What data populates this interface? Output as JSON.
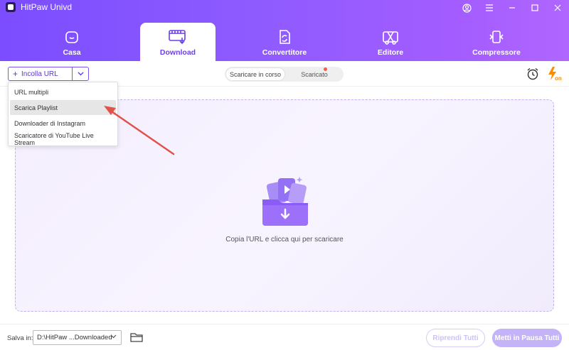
{
  "app": {
    "title": "HitPaw Univd"
  },
  "tabs": [
    {
      "label": "Casa",
      "icon": "home-icon"
    },
    {
      "label": "Download",
      "icon": "download-icon",
      "active": true
    },
    {
      "label": "Convertitore",
      "icon": "converter-icon"
    },
    {
      "label": "Editore",
      "icon": "editor-icon"
    },
    {
      "label": "Compressore",
      "icon": "compressor-icon"
    }
  ],
  "toolbar": {
    "paste_url_label": "Incolla URL",
    "segment_downloading": "Scaricare in corso",
    "segment_downloaded": "Scaricato"
  },
  "menu": {
    "items": [
      {
        "label": "URL multipli"
      },
      {
        "label": "Scarica Playlist",
        "hover": true
      },
      {
        "label": "Downloader di Instagram"
      },
      {
        "label": "Scaricatore di YouTube Live Stream"
      }
    ]
  },
  "drop_area": {
    "hint": "Copia l'URL e clicca qui per scaricare"
  },
  "footer": {
    "save_label": "Salva in:",
    "save_path": "D:\\HitPaw ...Downloaded",
    "resume_all_label": "Riprendi Tutti",
    "pause_all_label": "Metti in Pausa Tutti"
  },
  "colors": {
    "accent": "#7b4dff",
    "notification": "#ff5a3c",
    "annotation_arrow": "#e0524a"
  }
}
